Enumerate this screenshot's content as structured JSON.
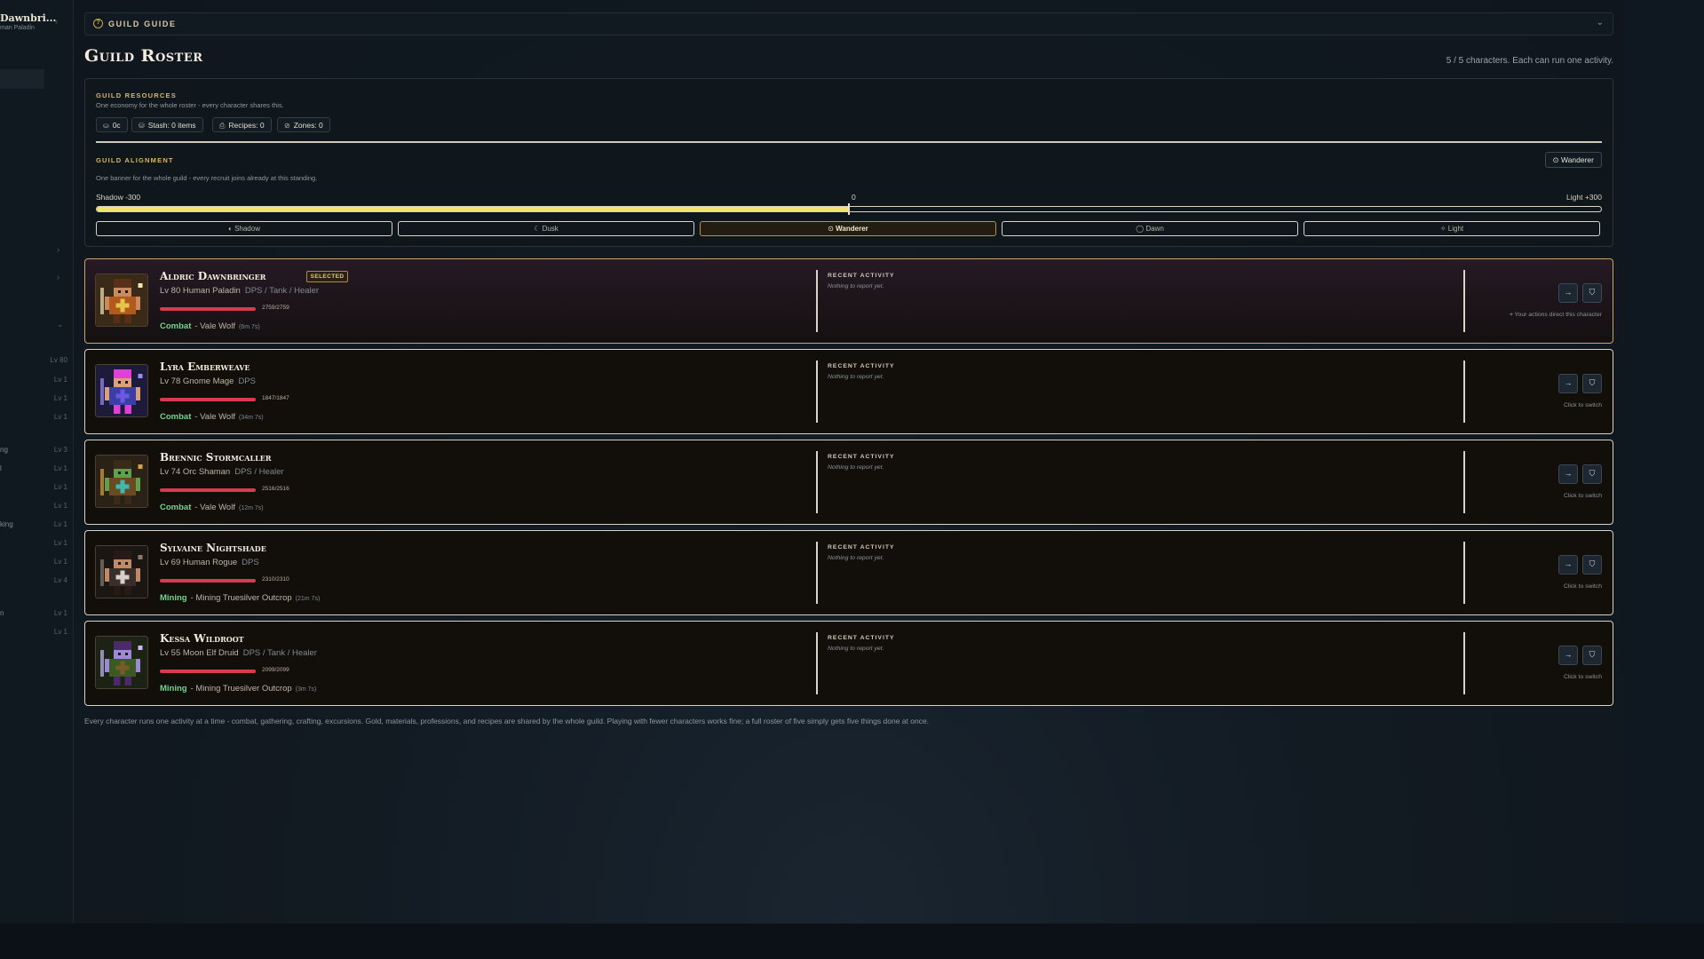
{
  "sidebar": {
    "character_name": "Dawnbri...",
    "character_sub": "man Paladin",
    "collapse_icon": "chevron-left-icon",
    "rows": [
      {
        "label": "",
        "level": "Lv 80"
      },
      {
        "label": "",
        "level": "Lv 1"
      },
      {
        "label": "",
        "level": "Lv 1"
      },
      {
        "label": "",
        "level": "Lv 1"
      },
      {
        "label": "ng",
        "level": "Lv 3"
      },
      {
        "label": "l",
        "level": "Lv 1"
      },
      {
        "label": "",
        "level": "Lv 1"
      },
      {
        "label": "",
        "level": "Lv 1"
      },
      {
        "label": "king",
        "level": "Lv 1"
      },
      {
        "label": "",
        "level": "Lv 1"
      },
      {
        "label": "",
        "level": "Lv 1"
      },
      {
        "label": "",
        "level": "Lv 4"
      },
      {
        "label": "n",
        "level": "Lv 1"
      },
      {
        "label": "",
        "level": "Lv 1"
      }
    ]
  },
  "guide": {
    "title": "GUILD GUIDE",
    "icon": "question-circle-icon"
  },
  "page": {
    "title": "Guild Roster",
    "count_text": "5 / 5 characters. Each can run one activity."
  },
  "resources": {
    "title": "GUILD RESOURCES",
    "subtitle": "One economy for the whole roster - every character shares this.",
    "chips": [
      {
        "icon": "coin-icon",
        "text": "0c"
      },
      {
        "icon": "stash-icon",
        "text": "Stash: 0 items"
      },
      {
        "icon": "recipe-icon",
        "text": "Recipes: 0"
      },
      {
        "icon": "zone-icon",
        "text": "Zones: 0"
      }
    ]
  },
  "alignment": {
    "title": "GUILD ALIGNMENT",
    "subtitle": "One banner for the whole guild - every recruit joins already at this standing.",
    "current_label": "Wanderer",
    "min_label": "Shadow -300",
    "mid_label": "0",
    "max_label": "Light +300",
    "value": 0,
    "min": -300,
    "max": 300,
    "fill_fraction": 0.5,
    "fill_color": "#f2e46b",
    "options": [
      {
        "label": "Shadow",
        "icon": "shadow-icon",
        "active": false
      },
      {
        "label": "Dusk",
        "icon": "dusk-icon",
        "active": false
      },
      {
        "label": "Wanderer",
        "icon": "compass-icon",
        "active": true
      },
      {
        "label": "Dawn",
        "icon": "dawn-icon",
        "active": false
      },
      {
        "label": "Light",
        "icon": "sparkle-icon",
        "active": false
      }
    ]
  },
  "characters": [
    {
      "name": "Aldric Dawnbringer",
      "selected": true,
      "badge": "SELECTED",
      "level_race_class": "Lv 80 Human Paladin",
      "roles": "DPS / Tank / Healer",
      "hp_text": "2759/2759",
      "hp_fraction": 1,
      "activity_kind": "Combat",
      "activity_target": "- Vale Wolf",
      "activity_time": "(6m 7s)",
      "recent_title": "RECENT ACTIVITY",
      "recent_text": "Nothing to report yet.",
      "hint": "Your actions direct this character"
    },
    {
      "name": "Lyra Emberweave",
      "selected": false,
      "badge": "",
      "level_race_class": "Lv 78 Gnome Mage",
      "roles": "DPS",
      "hp_text": "1847/1847",
      "hp_fraction": 1,
      "activity_kind": "Combat",
      "activity_target": "- Vale Wolf",
      "activity_time": "(34m 7s)",
      "recent_title": "RECENT ACTIVITY",
      "recent_text": "Nothing to report yet.",
      "hint": "Click to switch"
    },
    {
      "name": "Brennic Stormcaller",
      "selected": false,
      "badge": "",
      "level_race_class": "Lv 74 Orc Shaman",
      "roles": "DPS / Healer",
      "hp_text": "2516/2516",
      "hp_fraction": 1,
      "activity_kind": "Combat",
      "activity_target": "- Vale Wolf",
      "activity_time": "(12m 7s)",
      "recent_title": "RECENT ACTIVITY",
      "recent_text": "Nothing to report yet.",
      "hint": "Click to switch"
    },
    {
      "name": "Sylvaine Nightshade",
      "selected": false,
      "badge": "",
      "level_race_class": "Lv 69 Human Rogue",
      "roles": "DPS",
      "hp_text": "2310/2310",
      "hp_fraction": 1,
      "activity_kind": "Mining",
      "activity_target": "- Mining Truesilver Outcrop",
      "activity_time": "(21m 7s)",
      "recent_title": "RECENT ACTIVITY",
      "recent_text": "Nothing to report yet.",
      "hint": "Click to switch"
    },
    {
      "name": "Kessa Wildroot",
      "selected": false,
      "badge": "",
      "level_race_class": "Lv 55 Moon Elf Druid",
      "roles": "DPS / Tank / Healer",
      "hp_text": "2099/2099",
      "hp_fraction": 1,
      "activity_kind": "Mining",
      "activity_target": "- Mining Truesilver Outcrop",
      "activity_time": "(3m 7s)",
      "recent_title": "RECENT ACTIVITY",
      "recent_text": "Nothing to report yet.",
      "hint": "Click to switch"
    }
  ],
  "buttons": {
    "switch_icon": "arrow-right-icon",
    "view_icon": "shield-icon",
    "switch_glyph": "→",
    "view_glyph": "⛉",
    "hint_icon": "crosshair-icon"
  },
  "footnote": "Every character runs one activity at a time - combat, gathering, crafting, excursions. Gold, materials, professions, and recipes are shared by the whole guild. Playing with fewer characters works fine; a full roster of five simply gets five things done at once.",
  "colors": {
    "accent_gold": "#c9a64a",
    "hp_red": "#d63b4e",
    "activity_green": "#72d48d",
    "alignment_yellow": "#f2e46b"
  }
}
